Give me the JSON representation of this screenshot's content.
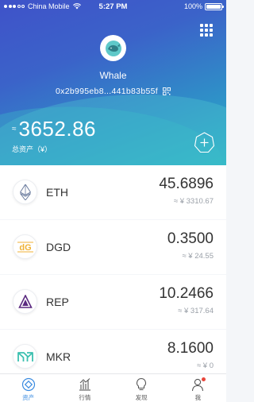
{
  "status_bar": {
    "carrier": "China Mobile",
    "time": "5:27 PM",
    "battery": "100%"
  },
  "wallet": {
    "name": "Whale",
    "address": "0x2b995eb8...441b83b55f",
    "balance": "3652.86",
    "balance_prefix": "≈",
    "total_label": "总资产（¥）"
  },
  "assets": [
    {
      "symbol": "ETH",
      "amount": "45.6896",
      "value": "≈ ¥ 3310.67",
      "icon": "eth-icon"
    },
    {
      "symbol": "DGD",
      "amount": "0.3500",
      "value": "≈ ¥ 24.55",
      "icon": "dgd-icon"
    },
    {
      "symbol": "REP",
      "amount": "10.2466",
      "value": "≈ ¥ 317.64",
      "icon": "rep-icon"
    },
    {
      "symbol": "MKR",
      "amount": "8.1600",
      "value": "≈ ¥ 0",
      "icon": "mkr-icon"
    }
  ],
  "tabs": [
    {
      "label": "资产",
      "icon": "assets-icon",
      "active": true
    },
    {
      "label": "行情",
      "icon": "market-icon",
      "active": false
    },
    {
      "label": "发现",
      "icon": "discover-icon",
      "active": false
    },
    {
      "label": "我",
      "icon": "profile-icon",
      "active": false
    }
  ],
  "colors": {
    "accent": "#3a8be0",
    "header_start": "#3f52c9",
    "header_end": "#2ab3c4",
    "badge": "#e8463b"
  }
}
